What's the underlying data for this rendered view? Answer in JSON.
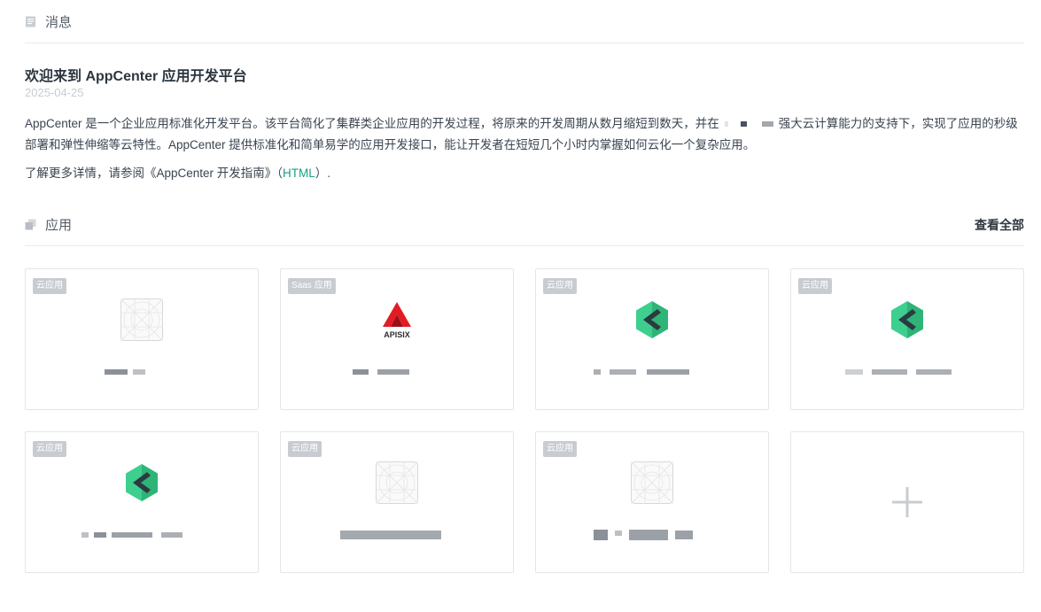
{
  "messages": {
    "section_title": "消息",
    "section_icon": "message-icon",
    "title": "欢迎来到 AppCenter 应用开发平台",
    "date": "2025-04-25",
    "body_part1": "AppCenter 是一个企业应用标准化开发平台。该平台简化了集群类企业应用的开发过程，将原来的开发周期从数月缩短到数天，并在",
    "body_part2": "强大云计算能力的支持下，实现了应用的秒级部署和弹性伸缩等云特性。AppCenter 提供标准化和简单易学的应用开发接口，能让开发者在短短几个小时内掌握如何云化一个复杂应用。",
    "more_prefix": "了解更多详情，请参阅《AppCenter 开发指南》（",
    "more_link": "HTML",
    "more_suffix": "）."
  },
  "apps": {
    "section_title": "应用",
    "section_icon": "apps-icon",
    "view_all": "查看全部",
    "cards": [
      {
        "badge": "云应用",
        "logo": "placeholder-image-icon"
      },
      {
        "badge": "Saas 应用",
        "logo": "apisix-logo"
      },
      {
        "badge": "云应用",
        "logo": "kubesphere-logo"
      },
      {
        "badge": "云应用",
        "logo": "kubesphere-logo"
      },
      {
        "badge": "云应用",
        "logo": "kubesphere-logo"
      },
      {
        "badge": "云应用",
        "logo": "placeholder-image-icon"
      },
      {
        "badge": "云应用",
        "logo": "placeholder-image-icon"
      }
    ],
    "add_card_icon": "plus-icon"
  },
  "colors": {
    "link": "#16a085",
    "badge": "#c8ccd1",
    "kube_green": "#3ecf8e",
    "apisix_red": "#e31b23"
  },
  "logo_text": {
    "apisix": "APISIX"
  }
}
